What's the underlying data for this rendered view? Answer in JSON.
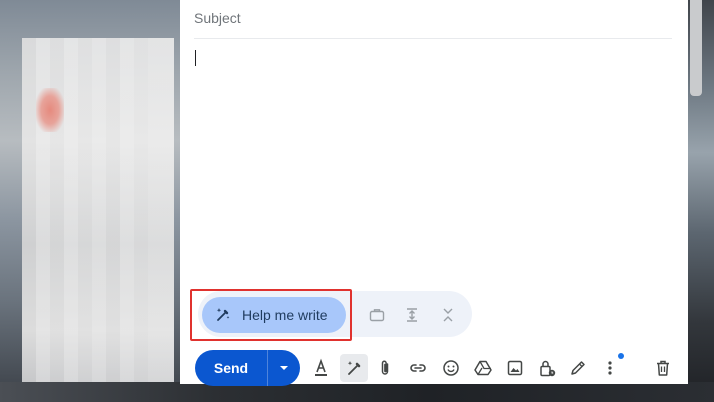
{
  "compose": {
    "subject_placeholder": "Subject"
  },
  "ai_bar": {
    "help_label": "Help me write",
    "icons": [
      "briefcase-icon",
      "expand-vertical-icon",
      "collapse-vertical-icon"
    ]
  },
  "toolbar": {
    "send_label": "Send",
    "icons": [
      "format-text-icon",
      "pen-sparkle-icon",
      "attach-icon",
      "link-icon",
      "emoji-icon",
      "drive-icon",
      "photo-icon",
      "confidential-lock-icon",
      "signature-icon",
      "more-options-icon",
      "trash-icon"
    ]
  },
  "colors": {
    "send": "#0b57d0",
    "help_button": "#a8c7fa",
    "highlight": "#e0322e",
    "notification_dot": "#1a73e8"
  }
}
